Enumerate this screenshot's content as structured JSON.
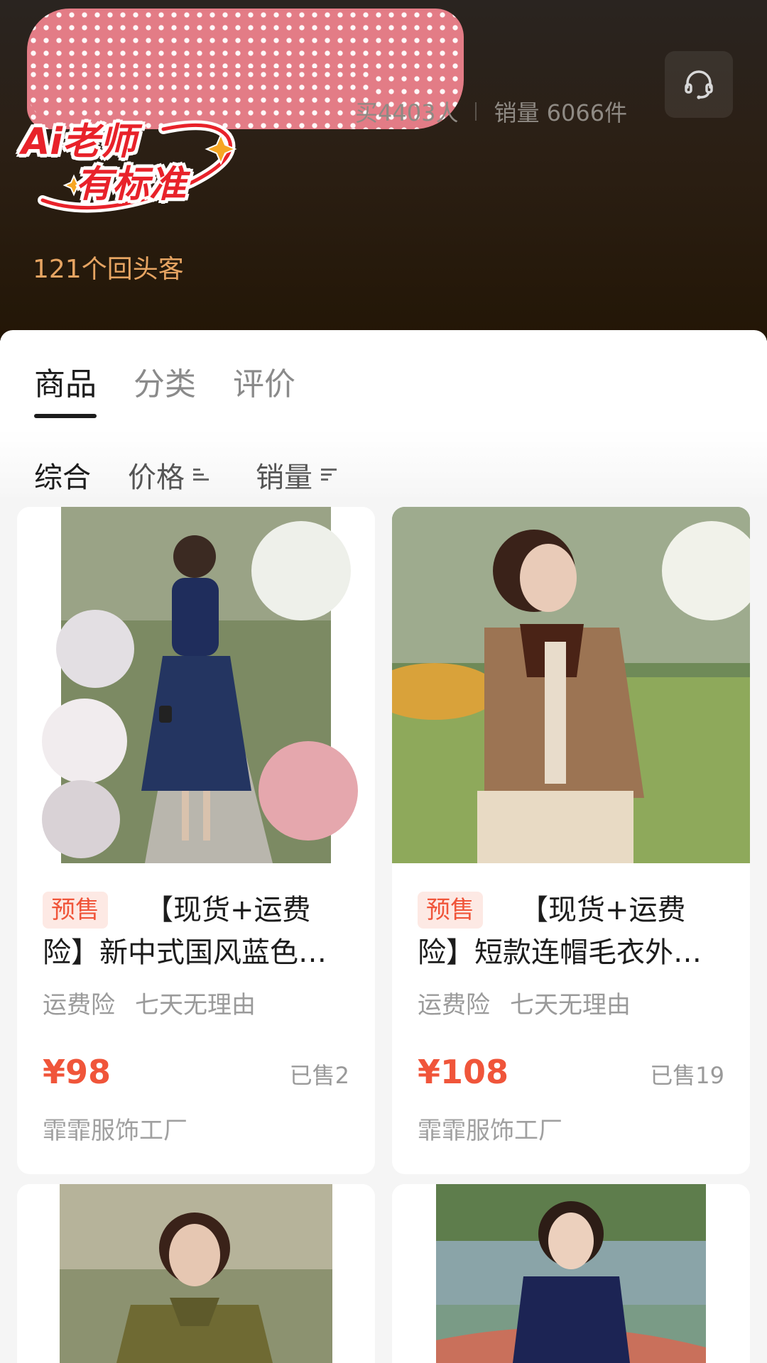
{
  "header": {
    "stats": {
      "bought_partial": "买4403人",
      "sales": "销量 6066件"
    },
    "badge": {
      "line1": "Ai老师",
      "line2": "有标准"
    },
    "returning_customers": "121个回头客",
    "service_icon": "headset-icon"
  },
  "tabs": [
    {
      "label": "商品",
      "active": true
    },
    {
      "label": "分类",
      "active": false
    },
    {
      "label": "评价",
      "active": false
    }
  ],
  "sort": {
    "comprehensive": "综合",
    "price": "价格",
    "sales": "销量"
  },
  "products": [
    {
      "presale": "预售",
      "title": "【现货+运费险】新中式国风蓝色…",
      "tags": [
        "运费险",
        "七天无理由"
      ],
      "price": "¥98",
      "sold": "已售2",
      "shop": "霏霏服饰工厂"
    },
    {
      "presale": "预售",
      "title": "【现货+运费险】短款连帽毛衣外…",
      "tags": [
        "运费险",
        "七天无理由"
      ],
      "price": "¥108",
      "sold": "已售19",
      "shop": "霏霏服饰工厂"
    }
  ],
  "colors": {
    "accent": "#f0553a",
    "returning": "#e6a462",
    "header_dark": "#231606"
  }
}
